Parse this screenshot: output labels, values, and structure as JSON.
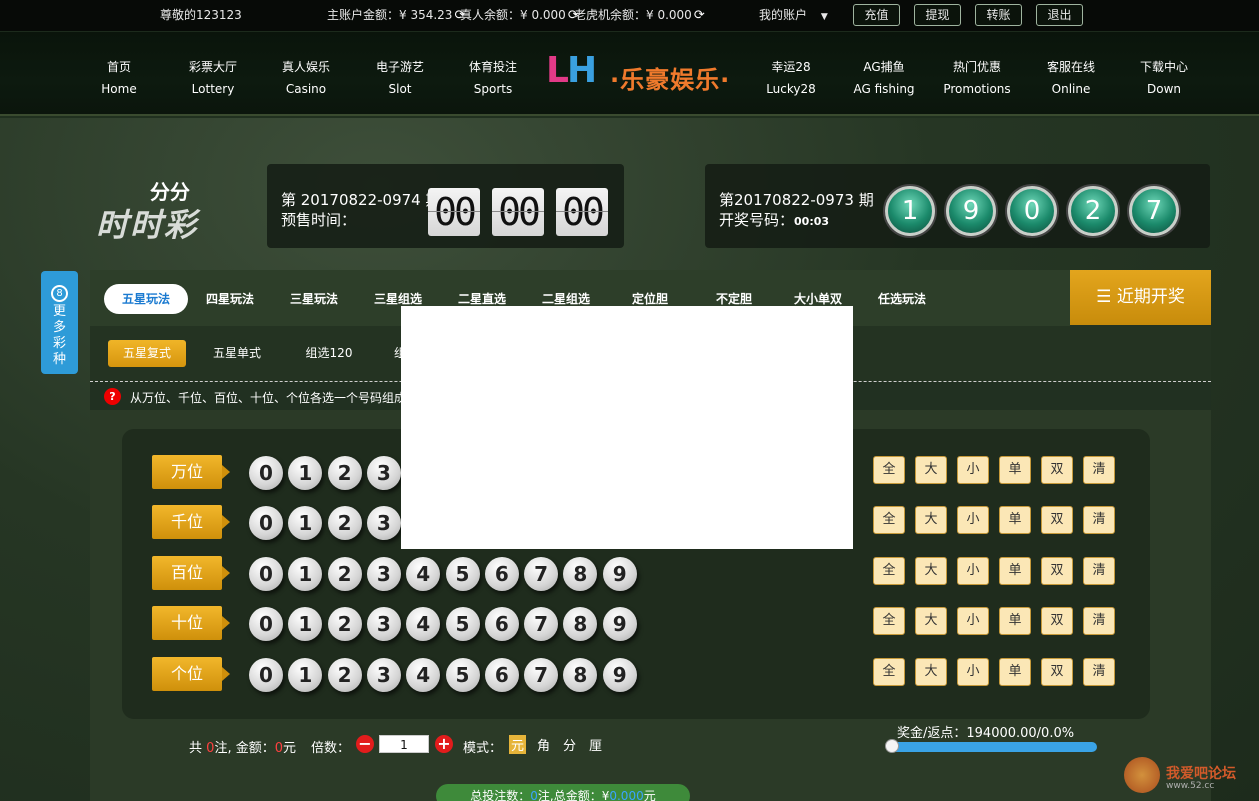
{
  "topbar": {
    "greeting": "尊敬的123123",
    "balances": "主账户金额：¥ 354.23",
    "live_balance": "真人余额：¥ 0.000",
    "slot_balance": "老虎机余额：¥ 0.000",
    "account": "我的账户",
    "buttons": [
      "充值",
      "提现",
      "转账",
      "退出"
    ]
  },
  "nav": {
    "items": [
      {
        "cn": "首页",
        "en": "Home"
      },
      {
        "cn": "彩票大厅",
        "en": "Lottery"
      },
      {
        "cn": "真人娱乐",
        "en": "Casino"
      },
      {
        "cn": "电子游艺",
        "en": "Slot"
      },
      {
        "cn": "体育投注",
        "en": "Sports"
      },
      {
        "cn": "幸运28",
        "en": "Lucky28"
      },
      {
        "cn": "AG捕鱼",
        "en": "AG fishing"
      },
      {
        "cn": "热门优惠",
        "en": "Promotions"
      },
      {
        "cn": "客服在线",
        "en": "Online"
      },
      {
        "cn": "下载中心",
        "en": "Down"
      }
    ],
    "logo_latin": "LH",
    "logo_cn": "·乐豪娱乐·"
  },
  "game": {
    "logo_top": "分分",
    "logo_main": "时时彩",
    "current_issue": "第 20170822-0974 期",
    "presale_label": "预售时间：",
    "countdown": [
      "00",
      "00",
      "00"
    ],
    "last_issue": "第20170822-0973 期",
    "draw_label": "开奖号码：",
    "draw_time": "00:03",
    "draw_numbers": [
      "1",
      "9",
      "0",
      "2",
      "7"
    ]
  },
  "side_tab": {
    "icon": "8",
    "label": [
      "更",
      "多",
      "彩",
      "种"
    ]
  },
  "tabs": [
    "五星玩法",
    "四星玩法",
    "三星玩法",
    "三星组选",
    "二星直选",
    "二星组选",
    "定位胆",
    "不定胆",
    "大小单双",
    "任选玩法"
  ],
  "recent_draws": "近期开奖",
  "subtabs": [
    "五星复式",
    "五星单式",
    "组选120",
    "组"
  ],
  "hint": {
    "icon": "?",
    "text": "从万位、千位、百位、十位、个位各选一个号码组成一"
  },
  "positions": [
    "万位",
    "千位",
    "百位",
    "十位",
    "个位"
  ],
  "digits": [
    "0",
    "1",
    "2",
    "3",
    "4",
    "5",
    "6",
    "7",
    "8",
    "9"
  ],
  "quick_buttons": [
    "全",
    "大",
    "小",
    "单",
    "双",
    "清"
  ],
  "bottom": {
    "total_prefix": "共",
    "count": "0",
    "amount_label": "注, 金额：",
    "amount": "0",
    "unit": "元",
    "multiple_label": "倍数：",
    "multiple_value": "1",
    "mode_label": "模式：",
    "modes": [
      "元",
      "角",
      "分",
      "厘"
    ],
    "odds": "奖金/返点：194000.00/0.0%",
    "summary_prefix": "总投注数：",
    "summary_count": "0",
    "summary_mid": "注,总金额：¥",
    "summary_amount": "0.000",
    "summary_unit": "元"
  },
  "watermark": {
    "title": "我爱吧论坛",
    "url": "www.52.cc"
  }
}
